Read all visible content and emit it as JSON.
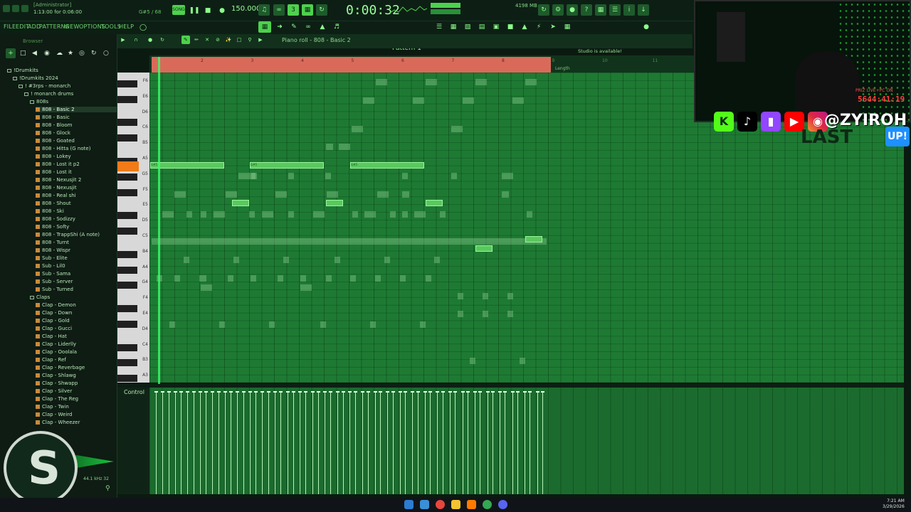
{
  "window": {
    "title_line1": "[Administrator]",
    "title_line2": "1:13:00 for 0:06:00",
    "hint": "G#5 / 68",
    "time": "0:00:32",
    "tempo": "150.000",
    "memory": "4198 MB",
    "pattern": "Pattern 1",
    "notice": "03:25 A newer version of FL Studio is available!"
  },
  "menu": [
    "FILE",
    "EDIT",
    "ADD",
    "PATTERNS",
    "VIEW",
    "OPTIONS",
    "TOOLS",
    "HELP"
  ],
  "browser": {
    "label": "Browser",
    "items": [
      {
        "label": "!Drumkits",
        "type": "folder",
        "indent": 0
      },
      {
        "label": "!Drumkits 2024",
        "type": "folder",
        "indent": 1
      },
      {
        "label": "! #3rps - monarch",
        "type": "folder",
        "indent": 2
      },
      {
        "label": "! monarch drums",
        "type": "folder",
        "indent": 3
      },
      {
        "label": "808s",
        "type": "folder",
        "indent": 4
      },
      {
        "label": "808 - Basic 2",
        "type": "file",
        "indent": 5,
        "selected": true
      },
      {
        "label": "808 - Basic",
        "type": "file",
        "indent": 5
      },
      {
        "label": "808 - Bloom",
        "type": "file",
        "indent": 5
      },
      {
        "label": "808 - Glock",
        "type": "file",
        "indent": 5
      },
      {
        "label": "808 - Goated",
        "type": "file",
        "indent": 5
      },
      {
        "label": "808 - Hitta (G note)",
        "type": "file",
        "indent": 5
      },
      {
        "label": "808 - Lokey",
        "type": "file",
        "indent": 5
      },
      {
        "label": "808 - Lost it p2",
        "type": "file",
        "indent": 5
      },
      {
        "label": "808 - Lost it",
        "type": "file",
        "indent": 5
      },
      {
        "label": "808 - Nexusjit 2",
        "type": "file",
        "indent": 5
      },
      {
        "label": "808 - Nexusjit",
        "type": "file",
        "indent": 5
      },
      {
        "label": "808 - Real shi",
        "type": "file",
        "indent": 5
      },
      {
        "label": "808 - Shout",
        "type": "file",
        "indent": 5
      },
      {
        "label": "808 - Ski",
        "type": "file",
        "indent": 5
      },
      {
        "label": "808 - Sodizzy",
        "type": "file",
        "indent": 5
      },
      {
        "label": "808 - Softy",
        "type": "file",
        "indent": 5
      },
      {
        "label": "808 - TrappShi (A note)",
        "type": "file",
        "indent": 5
      },
      {
        "label": "808 - Turnt",
        "type": "file",
        "indent": 5
      },
      {
        "label": "808 - Wispr",
        "type": "file",
        "indent": 5
      },
      {
        "label": "Sub - Elite",
        "type": "file",
        "indent": 5
      },
      {
        "label": "Sub - Lil0",
        "type": "file",
        "indent": 5
      },
      {
        "label": "Sub - Sama",
        "type": "file",
        "indent": 5
      },
      {
        "label": "Sub - Server",
        "type": "file",
        "indent": 5
      },
      {
        "label": "Sub - Turned",
        "type": "file",
        "indent": 5
      },
      {
        "label": "Claps",
        "type": "folder",
        "indent": 4
      },
      {
        "label": "Clap - Demon",
        "type": "file",
        "indent": 5
      },
      {
        "label": "Clap - Down",
        "type": "file",
        "indent": 5
      },
      {
        "label": "Clap - Gold",
        "type": "file",
        "indent": 5
      },
      {
        "label": "Clap - Gucci",
        "type": "file",
        "indent": 5
      },
      {
        "label": "Clap - Hat",
        "type": "file",
        "indent": 5
      },
      {
        "label": "Clap - Liderlly",
        "type": "file",
        "indent": 5
      },
      {
        "label": "Clap - Ooolala",
        "type": "file",
        "indent": 5
      },
      {
        "label": "Clap - Ref",
        "type": "file",
        "indent": 5
      },
      {
        "label": "Clap - Reverbage",
        "type": "file",
        "indent": 5
      },
      {
        "label": "Clap - Shlawg",
        "type": "file",
        "indent": 5
      },
      {
        "label": "Clap - Shwapp",
        "type": "file",
        "indent": 5
      },
      {
        "label": "Clap - Silver",
        "type": "file",
        "indent": 5
      },
      {
        "label": "Clap - The Reg",
        "type": "file",
        "indent": 5
      },
      {
        "label": "Clap - Twin",
        "type": "file",
        "indent": 5
      },
      {
        "label": "Clap - Weird",
        "type": "file",
        "indent": 5
      },
      {
        "label": "Clap - Wheezer",
        "type": "file",
        "indent": 5
      }
    ]
  },
  "piano_roll": {
    "title": "Piano roll - 808 - Basic 2",
    "length_label": "Length",
    "control_label": "Control",
    "bar_numbers": [
      "2",
      "3",
      "4",
      "5",
      "6",
      "7",
      "8",
      "9",
      "10",
      "11"
    ],
    "key_labels": [
      "F6",
      "E6",
      "D6",
      "C6",
      "B5",
      "A5",
      "G5",
      "F5",
      "E5",
      "D5",
      "C5",
      "B4",
      "A4",
      "G4",
      "F4",
      "E4",
      "D4",
      "C4",
      "B3",
      "A3"
    ],
    "note_label": "G#5"
  },
  "stream": {
    "live_text": "PRIZ LIVE+PC ON",
    "timer": "5644:41:19",
    "handle": "@ZYIROH",
    "last_text": "LAST",
    "up_badge": "UP!",
    "socials": [
      "K",
      "tiktok",
      "twitch",
      "youtube",
      "instagram"
    ]
  },
  "sample_rate": "44.1 kHz 32",
  "taskbar": {
    "time": "7:21 AM",
    "date": "3/29/2026"
  },
  "colors": {
    "grid": "#1e7a33",
    "loop": "#d96a5a",
    "active_key": "#f07b18",
    "note": "#59c95e"
  }
}
